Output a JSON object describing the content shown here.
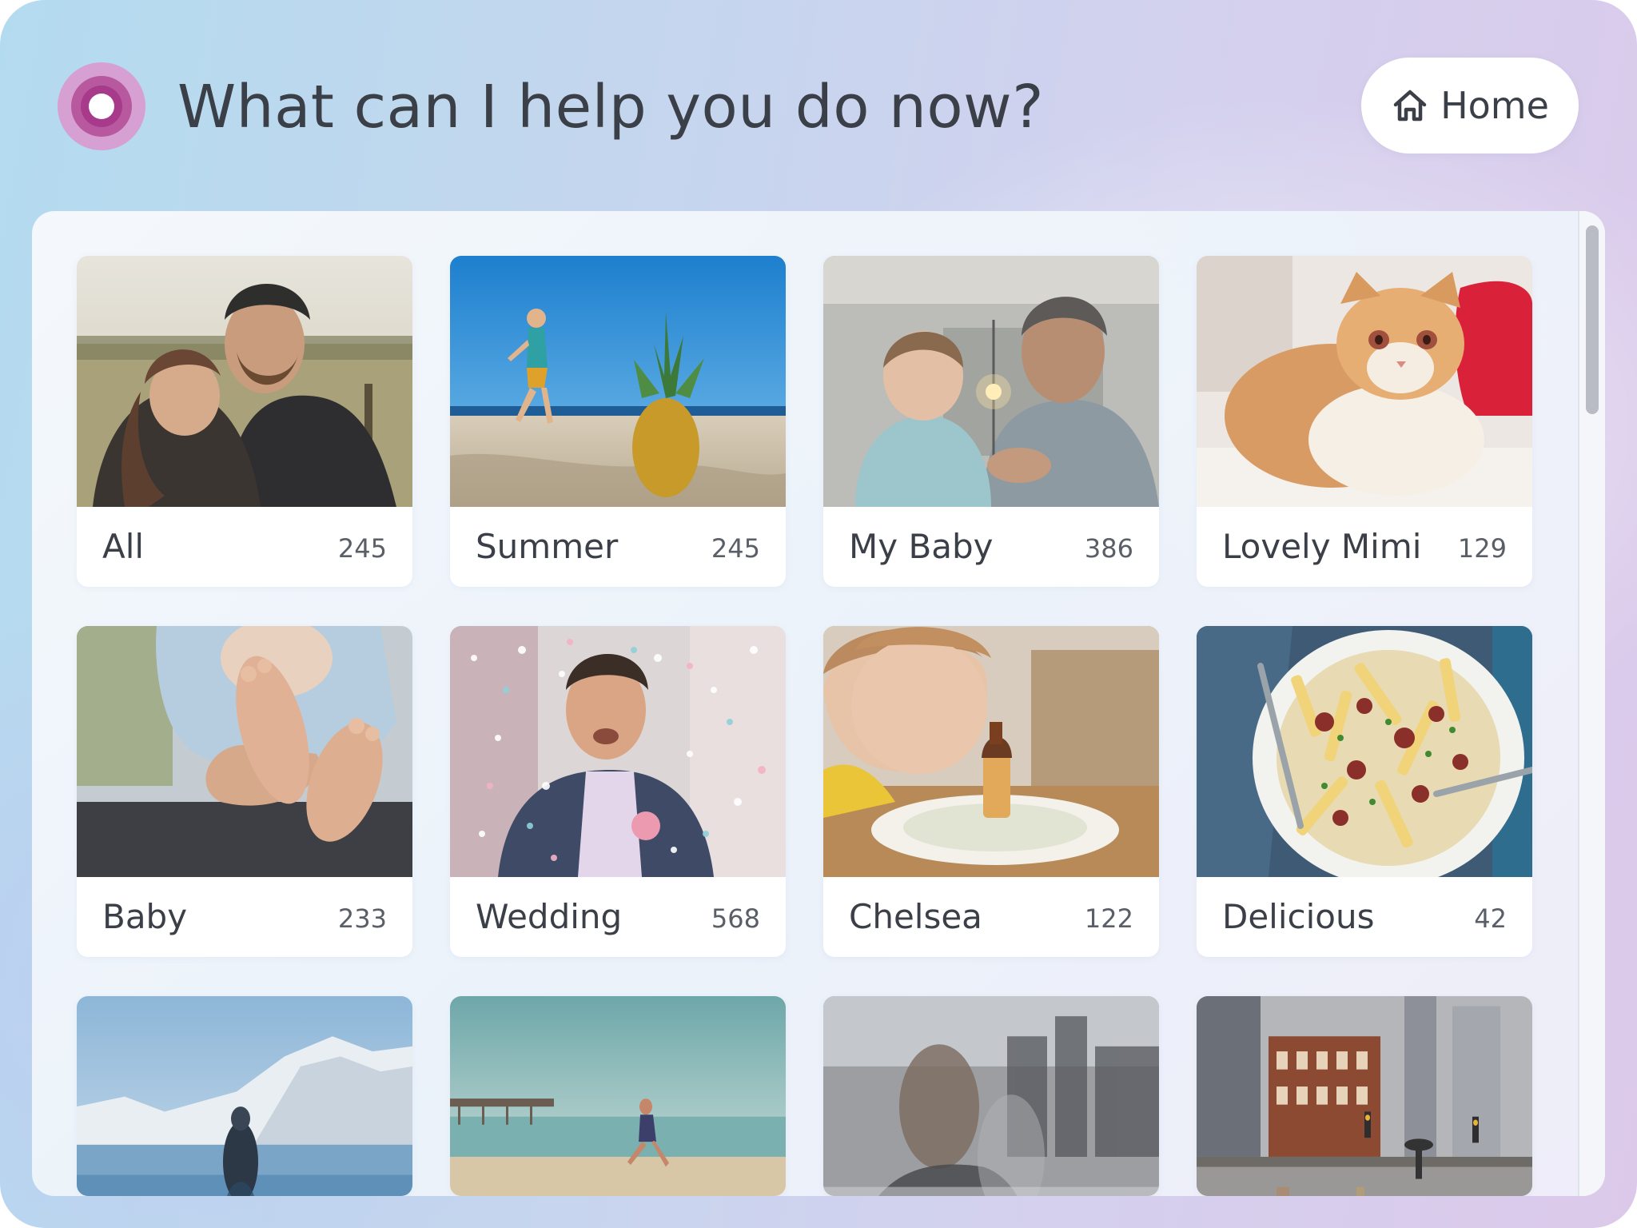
{
  "header": {
    "prompt": "What can I help you do now?",
    "home_button_label": "Home"
  },
  "albums": [
    {
      "label": "All",
      "count": "245"
    },
    {
      "label": "Summer",
      "count": "245"
    },
    {
      "label": "My Baby",
      "count": "386"
    },
    {
      "label": "Lovely Mimi",
      "count": "129"
    },
    {
      "label": "Baby",
      "count": "233"
    },
    {
      "label": "Wedding",
      "count": "568"
    },
    {
      "label": "Chelsea",
      "count": "122"
    },
    {
      "label": "Delicious",
      "count": "42"
    }
  ],
  "partial_albums": [
    {
      "thumbnail": "mountain-lake-photo"
    },
    {
      "thumbnail": "beach-pier-photo"
    },
    {
      "thumbnail": "window-reflection-photo"
    },
    {
      "thumbnail": "rainy-city-street-photo"
    }
  ],
  "scrollbar": {
    "position": 0
  }
}
